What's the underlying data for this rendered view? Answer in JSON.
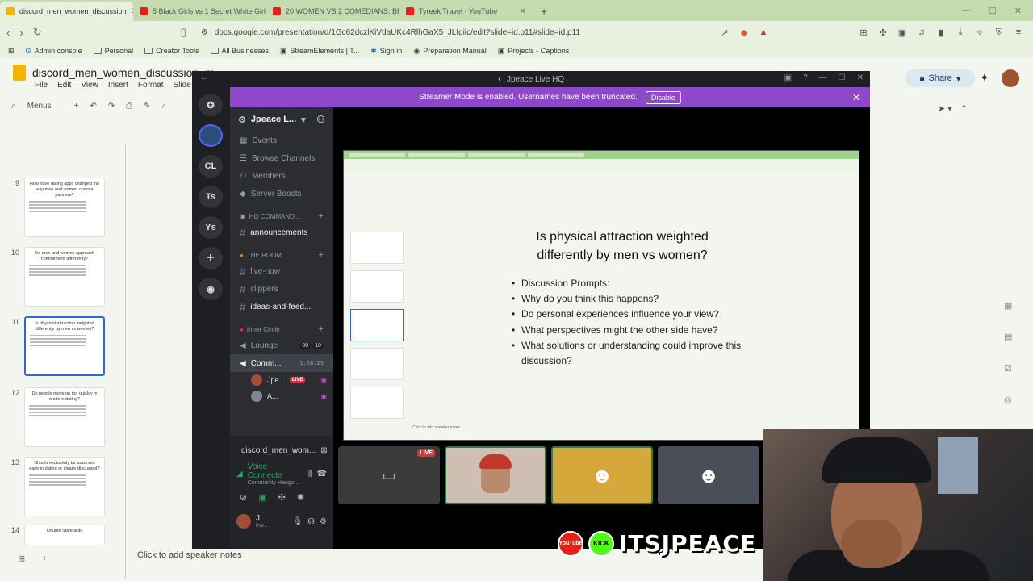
{
  "browser": {
    "tabs": [
      {
        "title": "discord_men_women_discussion",
        "color": "#f4b400",
        "active": true
      },
      {
        "title": "5 Black Girls vs 1 Secret White Girl",
        "color": "#e62117",
        "active": false
      },
      {
        "title": "20 WOMEN VS 2 COMEDIANS: BRO",
        "color": "#e62117",
        "active": false
      },
      {
        "title": "Tyreek Travel - YouTube",
        "color": "#e62117",
        "active": false
      }
    ],
    "url": "docs.google.com/presentation/d/1Gc62dczlKiVdaUKc4RlhGaX5_JLIgilc/edit?slide=id.p11#slide=id.p11",
    "bookmarks": [
      "Admin console",
      "Personal",
      "Creator Tools",
      "All Businesses",
      "StreamElements | T...",
      "Sign in",
      "Preparation Manual",
      "Projects - Captions"
    ]
  },
  "slides": {
    "doc_name": "discord_men_women_discussion_ni",
    "menus": [
      "File",
      "Edit",
      "View",
      "Insert",
      "Format",
      "Slide"
    ],
    "menus_search": "Menus",
    "share_label": "Share",
    "speaker_notes": "Click to add speaker notes",
    "thumbnails": [
      {
        "num": "9",
        "title": "How have dating apps changed the way men and women choose partners?",
        "selected": false
      },
      {
        "num": "10",
        "title": "Do men and women approach commitment differently?",
        "selected": false
      },
      {
        "num": "11",
        "title": "Is physical attraction weighted differently by men vs women?",
        "selected": true
      },
      {
        "num": "12",
        "title": "Do people move on too quickly in modern dating?",
        "selected": false
      },
      {
        "num": "13",
        "title": "Should exclusivity be assumed early in dating or clearly discussed?",
        "selected": false
      },
      {
        "num": "14",
        "title": "Double Standards",
        "selected": false
      }
    ]
  },
  "discord": {
    "window_title": "Jpeace Live HQ",
    "banner_text": "Streamer Mode is enabled. Usernames have been truncated.",
    "banner_button": "Disable",
    "guilds": [
      "CL",
      "Ts",
      "Ys"
    ],
    "server_name": "Jpeace L...",
    "nav_items": [
      "Events",
      "Browse Channels",
      "Members",
      "Server Boosts"
    ],
    "cat_command": "HQ COMMAND ...",
    "ch_announcements": "announcements",
    "cat_room": "THE ROOM",
    "ch_live_now": "live-now",
    "ch_clippers": "clippers",
    "ch_ideas": "ideas-and-feed...",
    "cat_inner": "Inner Circle",
    "ch_lounge": "Lounge",
    "lounge_count_a": "00",
    "lounge_count_b": "10",
    "ch_community": "Comm...",
    "community_timer": "1:58:29",
    "vc_user_1": "Jpe...",
    "vc_user_1_badge": "LIVE",
    "vc_user_2": "A...",
    "stream_title": "discord_men_wom...",
    "voice_status": "Voice Connecte",
    "voice_sub": "Community Hango...",
    "user_name": "J...",
    "user_sub": "Inv..."
  },
  "stream": {
    "slide_title": "Is physical attraction weighted differently by men vs women?",
    "bullets": [
      "Discussion Prompts:",
      "Why do you think this happens?",
      "Do personal experiences influence your view?",
      "What perspectives might the other side have?",
      "What solutions or understanding could improve this discussion?"
    ],
    "tile_badge": "LIVE",
    "yt_label": "YouTube",
    "kick_label": "KICK",
    "handle": "ITSJPEACE"
  }
}
